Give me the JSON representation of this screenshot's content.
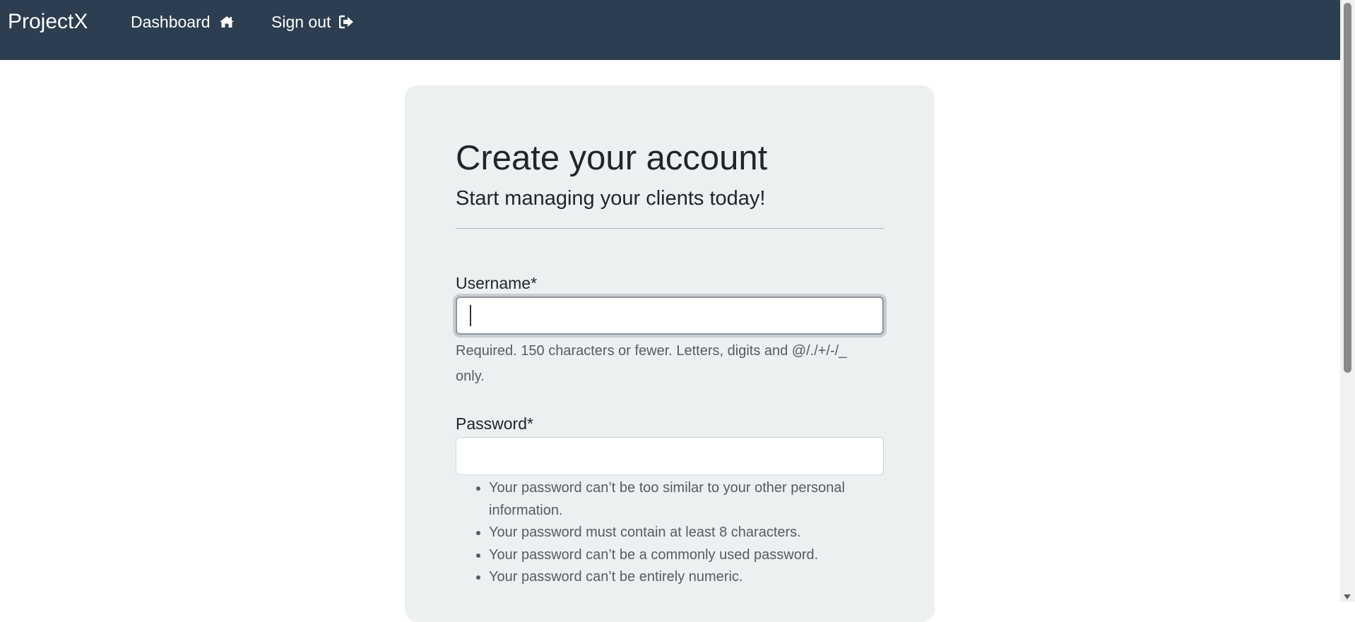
{
  "navbar": {
    "brand": "ProjectX",
    "links": [
      {
        "label": "Dashboard",
        "icon": "home-icon"
      },
      {
        "label": "Sign out",
        "icon": "sign-out-icon"
      }
    ],
    "background": "#2c3e50"
  },
  "form": {
    "title": "Create your account",
    "subtitle": "Start managing your clients today!",
    "username": {
      "label": "Username*",
      "value": "",
      "help": "Required. 150 characters or fewer. Letters, digits and @/./+/-/_ only."
    },
    "password": {
      "label": "Password*",
      "value": "",
      "help": [
        "Your password can’t be too similar to your other personal information.",
        "Your password must contain at least 8 characters.",
        "Your password can’t be a commonly used password.",
        "Your password can’t be entirely numeric."
      ]
    }
  },
  "colors": {
    "card_background": "#ecf0f1",
    "accent": "#2c3e50"
  }
}
